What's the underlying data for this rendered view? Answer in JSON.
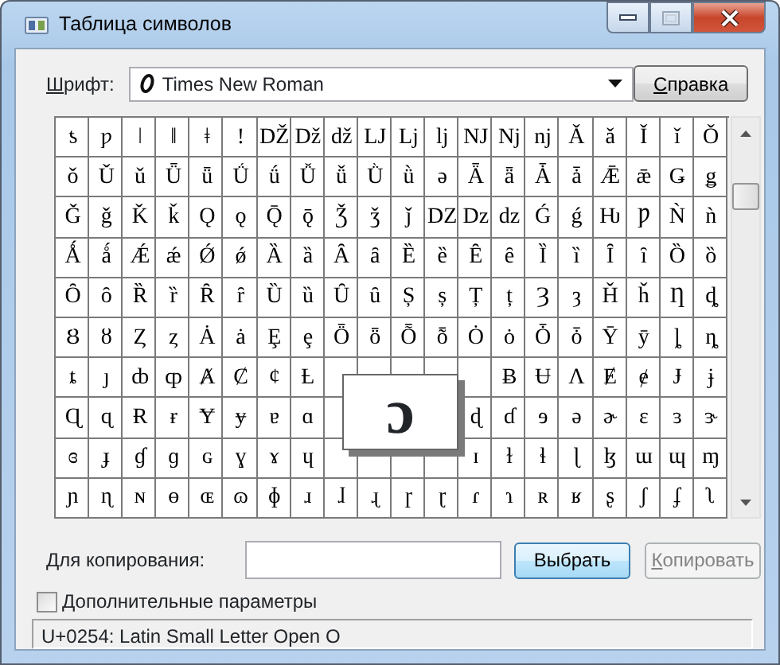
{
  "window": {
    "title": "Таблица символов"
  },
  "font": {
    "label": "Шрифт:",
    "value": "Times New Roman"
  },
  "help_button": "Справка",
  "grid": {
    "magnified": "ɔ",
    "rows": [
      [
        "ƾ",
        "ƿ",
        "ǀ",
        "ǁ",
        "ǂ",
        "ǃ",
        "Ǆ",
        "ǅ",
        "ǆ",
        "Ǉ",
        "ǈ",
        "ǉ",
        "Ǌ",
        "ǋ",
        "ǌ",
        "Ǎ",
        "ǎ",
        "Ǐ",
        "ǐ",
        "Ǒ"
      ],
      [
        "ǒ",
        "Ǔ",
        "ǔ",
        "Ǖ",
        "ǖ",
        "Ǘ",
        "ǘ",
        "Ǚ",
        "ǚ",
        "Ǜ",
        "ǜ",
        "ǝ",
        "Ǟ",
        "ǟ",
        "Ǡ",
        "ǡ",
        "Ǣ",
        "ǣ",
        "Ǥ",
        "ǥ"
      ],
      [
        "Ǧ",
        "ǧ",
        "Ǩ",
        "ǩ",
        "Ǫ",
        "ǫ",
        "Ǭ",
        "ǭ",
        "Ǯ",
        "ǯ",
        "ǰ",
        "Ǳ",
        "ǲ",
        "ǳ",
        "Ǵ",
        "ǵ",
        "Ƕ",
        "Ƿ",
        "Ǹ",
        "ǹ"
      ],
      [
        "Ǻ",
        "ǻ",
        "Ǽ",
        "ǽ",
        "Ǿ",
        "ǿ",
        "Ȁ",
        "ȁ",
        "Ȃ",
        "ȃ",
        "Ȅ",
        "ȅ",
        "Ȇ",
        "ȇ",
        "Ȉ",
        "ȉ",
        "Ȋ",
        "ȋ",
        "Ȍ",
        "ȍ"
      ],
      [
        "Ȏ",
        "ȏ",
        "Ȑ",
        "ȑ",
        "Ȓ",
        "ȓ",
        "Ȕ",
        "ȕ",
        "Ȗ",
        "ȗ",
        "Ș",
        "ș",
        "Ț",
        "ț",
        "Ȝ",
        "ȝ",
        "Ȟ",
        "ȟ",
        "Ƞ",
        "ȡ"
      ],
      [
        "Ȣ",
        "ȣ",
        "Ȥ",
        "ȥ",
        "Ȧ",
        "ȧ",
        "Ȩ",
        "ȩ",
        "Ȫ",
        "ȫ",
        "Ȭ",
        "ȭ",
        "Ȯ",
        "ȯ",
        "Ȱ",
        "ȱ",
        "Ȳ",
        "ȳ",
        "ȴ",
        "ȵ"
      ],
      [
        "ȶ",
        "ȷ",
        "ȸ",
        "ȹ",
        "Ⱥ",
        "Ȼ",
        "ȼ",
        "Ƚ",
        null,
        null,
        null,
        null,
        null,
        "Ƀ",
        "Ʉ",
        "Ʌ",
        "Ɇ",
        "ɇ",
        "Ɉ",
        "ɉ"
      ],
      [
        "Ɋ",
        "ɋ",
        "Ɍ",
        "ɍ",
        "Ɏ",
        "ɏ",
        "ɐ",
        "ɑ",
        null,
        null,
        null,
        null,
        "ɖ",
        "ɗ",
        "ɘ",
        "ə",
        "ɚ",
        "ɛ",
        "ɜ",
        "ɝ"
      ],
      [
        "ɞ",
        "ɟ",
        "ɠ",
        "ɡ",
        "ɢ",
        "ɣ",
        "ɤ",
        "ɥ",
        null,
        null,
        null,
        null,
        "ɪ",
        "ɫ",
        "ɬ",
        "ɭ",
        "ɮ",
        "ɯ",
        "ɰ",
        "ɱ"
      ],
      [
        "ɲ",
        "ɳ",
        "ɴ",
        "ɵ",
        "ɶ",
        "ɷ",
        "ɸ",
        "ɹ",
        "ɺ",
        "ɻ",
        "ɼ",
        "ɽ",
        "ɾ",
        "ɿ",
        "ʀ",
        "ʁ",
        "ʂ",
        "ʃ",
        "ʄ",
        "ʅ"
      ]
    ]
  },
  "copy": {
    "label": "Для копирования:",
    "select_button": "Выбрать",
    "copy_button": {
      "label": "Копировать",
      "disabled": true
    }
  },
  "advanced": {
    "label": "Дополнительные параметры",
    "checked": false
  },
  "status_bar": "U+0254: Latin Small Letter Open O"
}
